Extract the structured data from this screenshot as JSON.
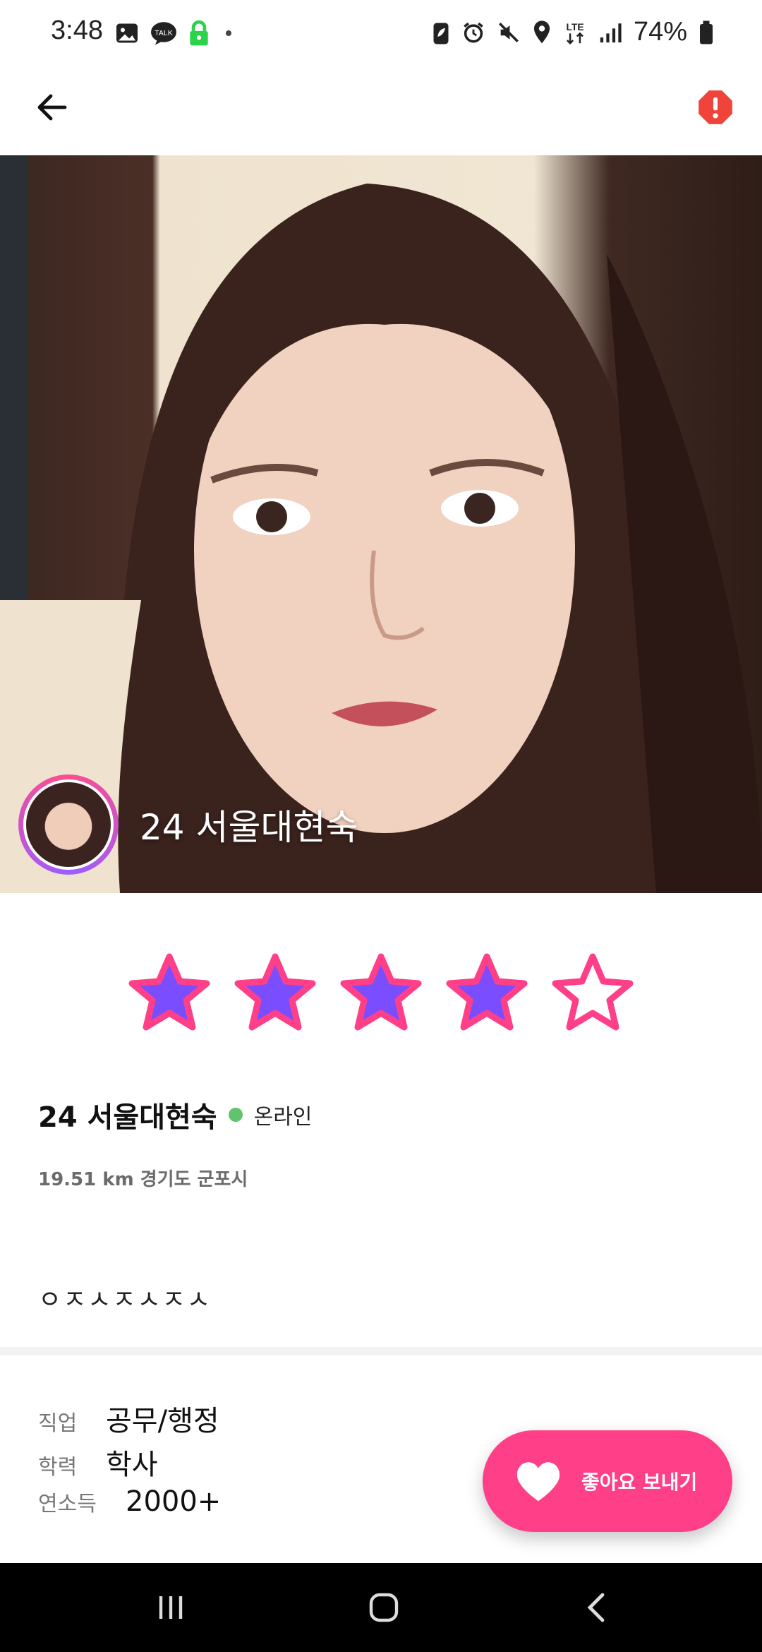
{
  "status_bar": {
    "time": "3:48",
    "battery": "74%",
    "notification_icons": [
      "gallery-icon",
      "kakaotalk-icon",
      "lock-icon",
      "dot-icon"
    ],
    "system_icons": [
      "battery-saver-icon",
      "alarm-icon",
      "mute-icon",
      "location-icon",
      "lte-icon",
      "signal-icon",
      "battery-icon"
    ],
    "lte_label": "LTE"
  },
  "appbar": {
    "back_icon": "arrow-left-icon",
    "report_icon": "alert-octagon-icon",
    "report_color": "#f0443a"
  },
  "hero": {
    "name": "24 서울대현숙"
  },
  "rating": {
    "value": 4,
    "max": 5,
    "fill_color": "#7a4dff",
    "stroke_color": "#ff3f88"
  },
  "profile": {
    "name": "24 서울대현숙",
    "status": "온라인",
    "status_color": "#5fc46d",
    "location": "19.51 km 경기도 군포시",
    "bio": "ㅇㅈㅅㅈㅅㅈㅅ"
  },
  "details": [
    {
      "label": "직업",
      "value": "공무/행정"
    },
    {
      "label": "학력",
      "value": "학사"
    },
    {
      "label": "연소득",
      "value": "2000+"
    }
  ],
  "like_button": {
    "label": "좋아요 보내기",
    "icon": "heart-icon",
    "color": "#ff3f88"
  },
  "navbar": {
    "recents_icon": "recents-icon",
    "home_icon": "home-icon",
    "back_icon": "nav-back-icon"
  }
}
